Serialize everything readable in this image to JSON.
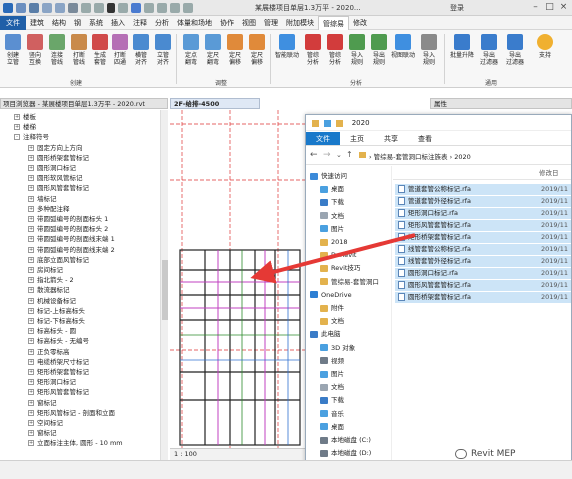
{
  "titlebar": {
    "title": "某展楼项目单层1.3万平 - 2020...",
    "login": "登录"
  },
  "menu": {
    "tabs": [
      "文件",
      "建筑",
      "结构",
      "钢",
      "系统",
      "插入",
      "注释",
      "分析",
      "体量和场地",
      "协作",
      "视图",
      "管理",
      "附加模块",
      "管综易",
      "修改"
    ]
  },
  "ribbon": {
    "buttons": [
      {
        "label": "创建\n立管"
      },
      {
        "label": "竖向\n互换"
      },
      {
        "label": "连接\n管线"
      },
      {
        "label": "打断\n管线"
      },
      {
        "label": "生成\n套管"
      },
      {
        "label": "打断\n四通"
      },
      {
        "label": "横管\n对齐"
      },
      {
        "label": "立管\n对齐"
      },
      {
        "label": "定点\n翻弯"
      },
      {
        "label": "定尺\n翻弯"
      },
      {
        "label": "定尺\n偏移"
      },
      {
        "label": "定尺\n偏移"
      },
      {
        "label": "智能联动"
      },
      {
        "label": "管综\n分析"
      },
      {
        "label": "管综\n分析"
      },
      {
        "label": "导入\n规则"
      },
      {
        "label": "导出\n规则"
      },
      {
        "label": "视图联动"
      },
      {
        "label": "导入\n规则"
      },
      {
        "label": "导出\n规则"
      },
      {
        "label": "批量升降"
      },
      {
        "label": "导出\n过滤器"
      },
      {
        "label": "导出\n过滤器"
      },
      {
        "label": "支持"
      }
    ],
    "panels": [
      "创建",
      "调整",
      "分析",
      "通用"
    ]
  },
  "project_browser": {
    "header": "项目浏览器 - 某展楼项目单层1.3万平 - 2020.rvt",
    "items": [
      {
        "label": "楼板",
        "box": "+"
      },
      {
        "label": "楼梯",
        "box": "+"
      },
      {
        "label": "注释符号",
        "box": "-"
      },
      {
        "label": "固定方向上方向",
        "box": "+"
      },
      {
        "label": "圆形桥架套管标记",
        "box": "+"
      },
      {
        "label": "圆形洞口标记",
        "box": "+"
      },
      {
        "label": "圆形软风管标记",
        "box": "+"
      },
      {
        "label": "圆形风管套管标记",
        "box": "+"
      },
      {
        "label": "墙标记",
        "box": "+"
      },
      {
        "label": "多种配注释",
        "box": "+"
      },
      {
        "label": "带圆弧编号的剖面标头 1",
        "box": "+"
      },
      {
        "label": "带圆弧编号的剖面标头 2",
        "box": "+"
      },
      {
        "label": "带圆弧编号的剖面线末端 1",
        "box": "+"
      },
      {
        "label": "带圆弧编号的剖面线末端 2",
        "box": "+"
      },
      {
        "label": "底部立面风管标记",
        "box": "+"
      },
      {
        "label": "房间标记",
        "box": "+"
      },
      {
        "label": "指北箭头 - 2",
        "box": "+"
      },
      {
        "label": "散流器标记",
        "box": "+"
      },
      {
        "label": "机械设备标记",
        "box": "+"
      },
      {
        "label": "标记-上标高标头",
        "box": "+"
      },
      {
        "label": "标记-下标高标头",
        "box": "+"
      },
      {
        "label": "标高标头 - 圆",
        "box": "+"
      },
      {
        "label": "标高标头 - 无编号",
        "box": "+"
      },
      {
        "label": "正负零标高",
        "box": "+"
      },
      {
        "label": "电缆桥架尺寸标记",
        "box": "+"
      },
      {
        "label": "矩形桥架套管标记",
        "box": "+"
      },
      {
        "label": "矩形洞口标记",
        "box": "+"
      },
      {
        "label": "矩形风管套管标记",
        "box": "+"
      },
      {
        "label": "窗标记",
        "box": "+"
      },
      {
        "label": "矩形风管标记 - 剖面和立面",
        "box": "+"
      },
      {
        "label": "空间标记",
        "box": "+"
      },
      {
        "label": "窗标记",
        "box": "+"
      },
      {
        "label": "立面标注主体, 圆形 - 10 mm",
        "box": "+"
      }
    ]
  },
  "view": {
    "tab": "2F-给排-4500",
    "scale": "1 : 100"
  },
  "properties": {
    "header": "属性"
  },
  "explorer": {
    "title": "2020",
    "tabs": [
      "文件",
      "主页",
      "共享",
      "查看"
    ],
    "breadcrumb": "› 管综易-套管洞口标注族表 › 2020",
    "column_header": "修改日",
    "nav_items": [
      {
        "label": "快速访问",
        "color": "#3b8ad9"
      },
      {
        "label": "桌面",
        "color": "#4aa0e0"
      },
      {
        "label": "下载",
        "color": "#3a7cc7"
      },
      {
        "label": "文档",
        "color": "#9aa5b1"
      },
      {
        "label": "图片",
        "color": "#4aa0e0"
      },
      {
        "label": "2018",
        "color": "#e3b24d"
      },
      {
        "label": "DeRevit",
        "color": "#e3b24d"
      },
      {
        "label": "Revit技巧",
        "color": "#e3b24d"
      },
      {
        "label": "管综易-套管洞口",
        "color": "#e3b24d"
      },
      {
        "label": "OneDrive",
        "color": "#2d7fd3"
      },
      {
        "label": "附件",
        "color": "#e3b24d"
      },
      {
        "label": "文档",
        "color": "#e3b24d"
      },
      {
        "label": "此电脑",
        "color": "#3a7cc7"
      },
      {
        "label": "3D 对象",
        "color": "#4aa0e0"
      },
      {
        "label": "视频",
        "color": "#6f7b88"
      },
      {
        "label": "图片",
        "color": "#4aa0e0"
      },
      {
        "label": "文档",
        "color": "#9aa5b1"
      },
      {
        "label": "下载",
        "color": "#3a7cc7"
      },
      {
        "label": "音乐",
        "color": "#4aa0e0"
      },
      {
        "label": "桌面",
        "color": "#4aa0e0"
      },
      {
        "label": "本地磁盘 (C:)",
        "color": "#6f7b88"
      },
      {
        "label": "本地磁盘 (D:)",
        "color": "#6f7b88"
      }
    ],
    "files": [
      {
        "name": "管道套管公称标记.rfa",
        "date": "2019/11"
      },
      {
        "name": "管道套管外径标记.rfa",
        "date": "2019/11"
      },
      {
        "name": "矩形洞口标记.rfa",
        "date": "2019/11"
      },
      {
        "name": "矩形风管套管标记.rfa",
        "date": "2019/11"
      },
      {
        "name": "矩形桥架套管标记.rfa",
        "date": "2019/11"
      },
      {
        "name": "线管套管公称标记.rfa",
        "date": "2019/11"
      },
      {
        "name": "线管套管外径标记.rfa",
        "date": "2019/11"
      },
      {
        "name": "圆形洞口标记.rfa",
        "date": "2019/11"
      },
      {
        "name": "圆形风管套管标记.rfa",
        "date": "2019/11"
      },
      {
        "name": "圆形桥架套管标记.rfa",
        "date": "2019/11"
      }
    ]
  },
  "watermark": "Revit MEP",
  "colors": {
    "accent": "#1f5fa8",
    "selection": "#cce4f7",
    "arrow": "#e53935"
  }
}
